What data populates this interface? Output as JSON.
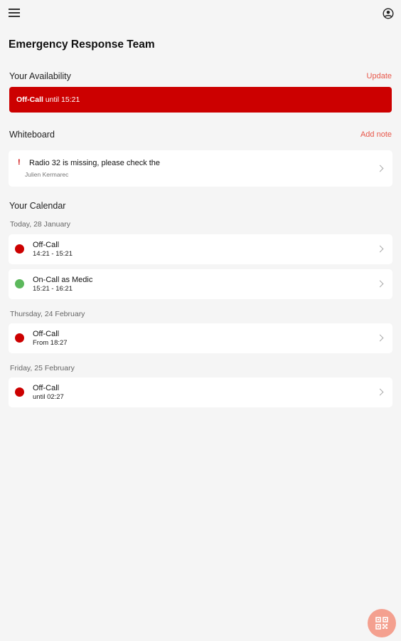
{
  "app": {
    "title": "Emergency Response Team"
  },
  "icons": {
    "menu": "menu-icon",
    "account": "account-circle-icon",
    "chevron": "chevron-right-icon",
    "alert": "exclamation-icon",
    "qr": "qr-code-icon"
  },
  "colors": {
    "accent": "#e8574a",
    "off_call": "#cc0000",
    "on_call": "#5cb85c",
    "fab": "#f4a08f"
  },
  "availability": {
    "label": "Your Availability",
    "action": "Update",
    "status": "Off-Call",
    "until": "until 15:21"
  },
  "whiteboard": {
    "label": "Whiteboard",
    "action": "Add note",
    "notes": [
      {
        "mark": "!",
        "title": "Radio 32 is missing, please check the",
        "author": "Julien Kermarec"
      }
    ]
  },
  "calendar": {
    "label": "Your Calendar",
    "days": [
      {
        "date": "Today, 28 January",
        "events": [
          {
            "title": "Off-Call",
            "time": "14:21 - 15:21",
            "status": "off"
          },
          {
            "title": "On-Call as Medic",
            "time": "15:21 - 16:21",
            "status": "on"
          }
        ]
      },
      {
        "date": "Thursday, 24 February",
        "events": [
          {
            "title": "Off-Call",
            "time": "From 18:27",
            "status": "off"
          }
        ]
      },
      {
        "date": "Friday, 25 February",
        "events": [
          {
            "title": "Off-Call",
            "time": "until 02:27",
            "status": "off"
          }
        ]
      }
    ]
  }
}
